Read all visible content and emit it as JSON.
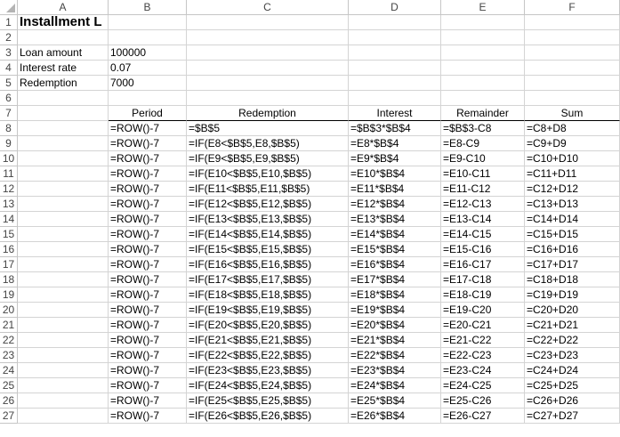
{
  "columns": [
    "A",
    "B",
    "C",
    "D",
    "E",
    "F"
  ],
  "rows": [
    "1",
    "2",
    "3",
    "4",
    "5",
    "6",
    "7",
    "8",
    "9",
    "10",
    "11",
    "12",
    "13",
    "14",
    "15",
    "16",
    "17",
    "18",
    "19",
    "20",
    "21",
    "22",
    "23",
    "24",
    "25",
    "26",
    "27"
  ],
  "title": "Installment L",
  "inputs": [
    {
      "label": "Loan amount",
      "value": "100000"
    },
    {
      "label": "Interest rate",
      "value": "0.07"
    },
    {
      "label": "Redemption",
      "value": "7000"
    }
  ],
  "table_headers": [
    "Period",
    "Redemption",
    "Interest",
    "Remainder",
    "Sum"
  ],
  "table_rows": [
    [
      "=ROW()-7",
      "=$B$5",
      "=$B$3*$B$4",
      "=$B$3-C8",
      "=C8+D8"
    ],
    [
      "=ROW()-7",
      "=IF(E8<$B$5,E8,$B$5)",
      "=E8*$B$4",
      "=E8-C9",
      "=C9+D9"
    ],
    [
      "=ROW()-7",
      "=IF(E9<$B$5,E9,$B$5)",
      "=E9*$B$4",
      "=E9-C10",
      "=C10+D10"
    ],
    [
      "=ROW()-7",
      "=IF(E10<$B$5,E10,$B$5)",
      "=E10*$B$4",
      "=E10-C11",
      "=C11+D11"
    ],
    [
      "=ROW()-7",
      "=IF(E11<$B$5,E11,$B$5)",
      "=E11*$B$4",
      "=E11-C12",
      "=C12+D12"
    ],
    [
      "=ROW()-7",
      "=IF(E12<$B$5,E12,$B$5)",
      "=E12*$B$4",
      "=E12-C13",
      "=C13+D13"
    ],
    [
      "=ROW()-7",
      "=IF(E13<$B$5,E13,$B$5)",
      "=E13*$B$4",
      "=E13-C14",
      "=C14+D14"
    ],
    [
      "=ROW()-7",
      "=IF(E14<$B$5,E14,$B$5)",
      "=E14*$B$4",
      "=E14-C15",
      "=C15+D15"
    ],
    [
      "=ROW()-7",
      "=IF(E15<$B$5,E15,$B$5)",
      "=E15*$B$4",
      "=E15-C16",
      "=C16+D16"
    ],
    [
      "=ROW()-7",
      "=IF(E16<$B$5,E16,$B$5)",
      "=E16*$B$4",
      "=E16-C17",
      "=C17+D17"
    ],
    [
      "=ROW()-7",
      "=IF(E17<$B$5,E17,$B$5)",
      "=E17*$B$4",
      "=E17-C18",
      "=C18+D18"
    ],
    [
      "=ROW()-7",
      "=IF(E18<$B$5,E18,$B$5)",
      "=E18*$B$4",
      "=E18-C19",
      "=C19+D19"
    ],
    [
      "=ROW()-7",
      "=IF(E19<$B$5,E19,$B$5)",
      "=E19*$B$4",
      "=E19-C20",
      "=C20+D20"
    ],
    [
      "=ROW()-7",
      "=IF(E20<$B$5,E20,$B$5)",
      "=E20*$B$4",
      "=E20-C21",
      "=C21+D21"
    ],
    [
      "=ROW()-7",
      "=IF(E21<$B$5,E21,$B$5)",
      "=E21*$B$4",
      "=E21-C22",
      "=C22+D22"
    ],
    [
      "=ROW()-7",
      "=IF(E22<$B$5,E22,$B$5)",
      "=E22*$B$4",
      "=E22-C23",
      "=C23+D23"
    ],
    [
      "=ROW()-7",
      "=IF(E23<$B$5,E23,$B$5)",
      "=E23*$B$4",
      "=E23-C24",
      "=C24+D24"
    ],
    [
      "=ROW()-7",
      "=IF(E24<$B$5,E24,$B$5)",
      "=E24*$B$4",
      "=E24-C25",
      "=C25+D25"
    ],
    [
      "=ROW()-7",
      "=IF(E25<$B$5,E25,$B$5)",
      "=E25*$B$4",
      "=E25-C26",
      "=C26+D26"
    ],
    [
      "=ROW()-7",
      "=IF(E26<$B$5,E26,$B$5)",
      "=E26*$B$4",
      "=E26-C27",
      "=C27+D27"
    ]
  ]
}
